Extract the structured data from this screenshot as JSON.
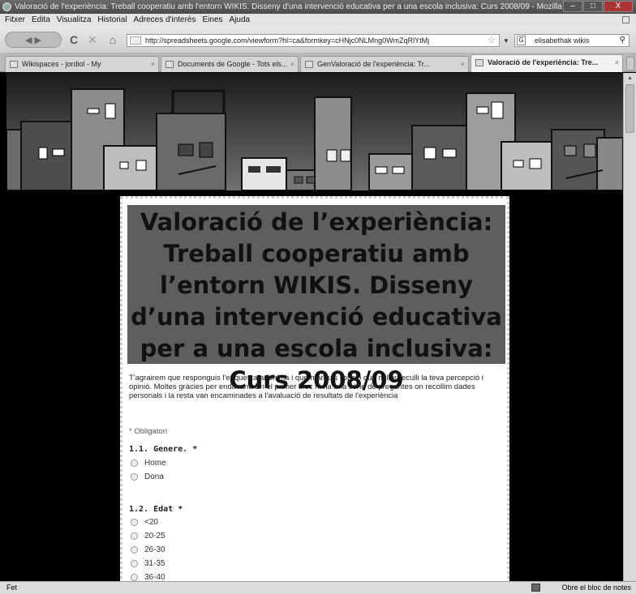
{
  "window": {
    "title": "Valoració de l'experiència: Treball cooperatiu amb l'entorn WIKIS. Disseny d'una intervenció educativa per a una escola inclusiva: Curs 2008/09 - Mozilla Fire...",
    "buttons": {
      "minimize": "–",
      "maximize": "□",
      "close": "X"
    }
  },
  "menu": [
    "Fitxer",
    "Edita",
    "Visualitza",
    "Historial",
    "Adreces d'interès",
    "Eines",
    "Ajuda"
  ],
  "nav": {
    "url": "http://spreadsheets.google.com/viewform?hl=ca&formkey=cHNjc0NLMng0WmZqRlYtMj",
    "search_value": "elisabethak wikis",
    "icons": {
      "back": "back-arrow-icon",
      "reload": "reload-icon",
      "stop": "stop-icon",
      "home": "home-icon"
    }
  },
  "tabs": [
    {
      "label": "Wikispaces - jordiol - My",
      "active": false
    },
    {
      "label": "Documents de Google - Tots els...",
      "active": false
    },
    {
      "label": "GenValoració de l'experiència: Tr...",
      "active": false
    },
    {
      "label": "Valoració de l'experiència: Tre...",
      "active": true
    }
  ],
  "form": {
    "title": "Valoració de l’experiència: Treball cooperatiu amb l’entorn WIKIS. Disseny d’una intervenció educativa per a una escola inclusiva: Curs 2008/09",
    "description": "T'agrairem que responguis l'enquesta anònima i que marquis l'opció que millor reculli la teva percepció i opinió. Moltes gràcies per endavant.  En el primer bloc hi ha una sèrie de preguntes on recollim dades personals i la resta van encaminades a l'avaluació de resultats de l'experiència",
    "required_note": "* Obligatori",
    "questions": [
      {
        "label": "1.1. Genere. *",
        "options": [
          "Home",
          "Dona"
        ]
      },
      {
        "label": "1.2. Edat *",
        "options": [
          "<20",
          "20-25",
          "26-30",
          "31-35",
          "36-40"
        ]
      }
    ]
  },
  "status": {
    "left": "Fet",
    "right": "Obre el bloc de notes"
  },
  "colors": {
    "title_bg": "#5e5e5e",
    "page_bg": "#000000",
    "card_bg": "#ffffff"
  }
}
